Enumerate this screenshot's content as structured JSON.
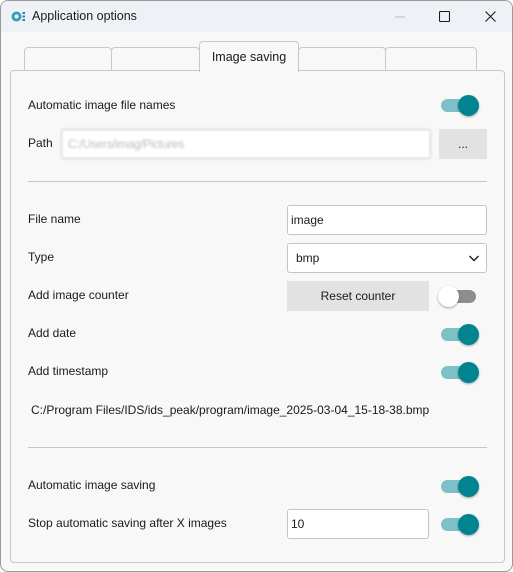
{
  "window": {
    "title": "Application options",
    "app_icon": "ids-peak-app-icon",
    "controls": {
      "minimize": "minimize-icon",
      "maximize": "maximize-icon",
      "close": "close-icon"
    }
  },
  "tabs": [
    {
      "label": "",
      "active": false
    },
    {
      "label": "",
      "active": false
    },
    {
      "label": "Image saving",
      "active": true
    },
    {
      "label": "",
      "active": false
    },
    {
      "label": "",
      "active": false
    }
  ],
  "colors": {
    "accent": "#00848f",
    "accent_track": "#7ec0c7",
    "off_track": "#8d8d8d"
  },
  "image_saving": {
    "automatic_file_names": {
      "label": "Automatic image file names",
      "enabled": true
    },
    "path": {
      "label": "Path",
      "value": "C:/Users/imag/Pictures",
      "browse_label": "..."
    },
    "file_name": {
      "label": "File name",
      "value": "image"
    },
    "type": {
      "label": "Type",
      "selected": "bmp"
    },
    "image_counter": {
      "label": "Add image counter",
      "reset_label": "Reset counter",
      "enabled": false
    },
    "add_date": {
      "label": "Add date",
      "enabled": true
    },
    "add_timestamp": {
      "label": "Add timestamp",
      "enabled": true
    },
    "preview_path": "C:/Program Files/IDS/ids_peak/program/image_2025-03-04_15-18-38.bmp",
    "automatic_saving": {
      "label": "Automatic image saving",
      "enabled": true
    },
    "stop_after": {
      "label": "Stop automatic saving after X images",
      "value": "10",
      "enabled": true
    }
  }
}
